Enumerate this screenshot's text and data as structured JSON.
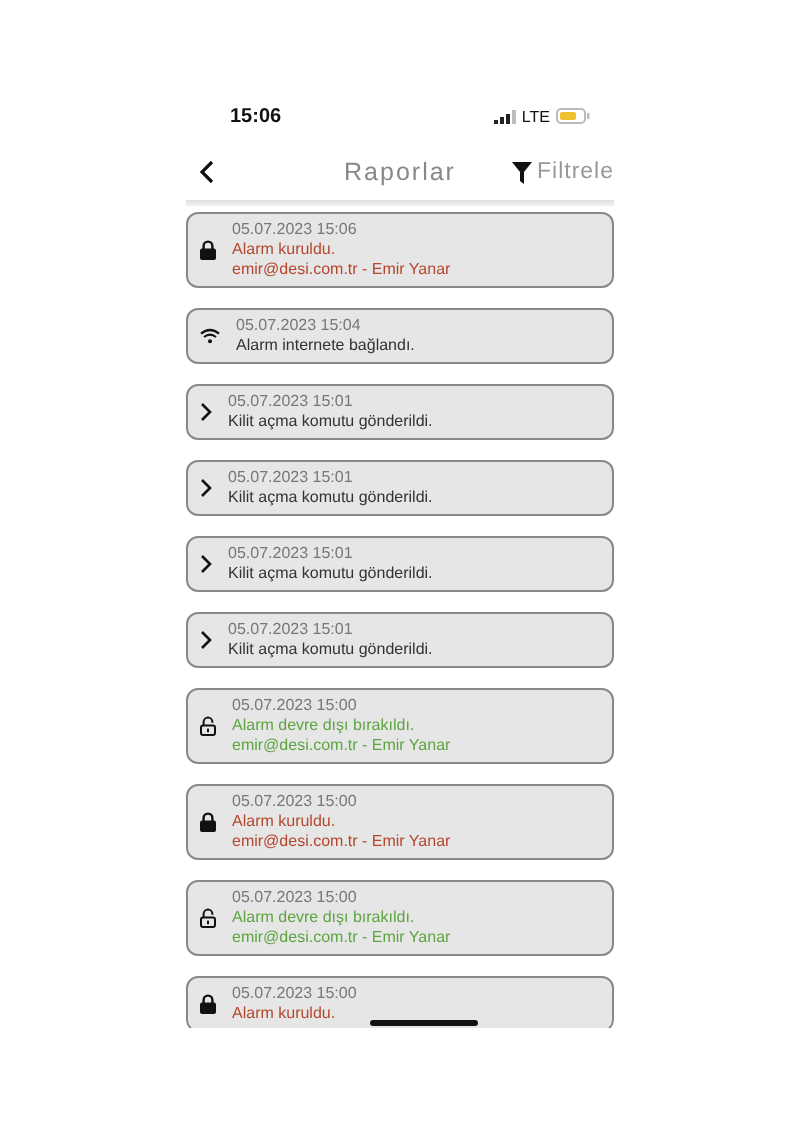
{
  "status_bar": {
    "time": "15:06",
    "network": "LTE"
  },
  "header": {
    "title": "Raporlar",
    "filter_label": "Filtrele"
  },
  "entries": [
    {
      "kind": "locked",
      "date": "05.07.2023 15:06",
      "message": "Alarm kuruldu.",
      "user": "emir@desi.com.tr - Emir Yanar"
    },
    {
      "kind": "wifi",
      "date": "05.07.2023 15:04",
      "message": "Alarm internete bağlandı."
    },
    {
      "kind": "command",
      "date": "05.07.2023 15:01",
      "message": "Kilit açma komutu gönderildi."
    },
    {
      "kind": "command",
      "date": "05.07.2023 15:01",
      "message": "Kilit açma komutu gönderildi."
    },
    {
      "kind": "command",
      "date": "05.07.2023 15:01",
      "message": "Kilit açma komutu gönderildi."
    },
    {
      "kind": "command",
      "date": "05.07.2023 15:01",
      "message": "Kilit açma komutu gönderildi."
    },
    {
      "kind": "unlocked",
      "date": "05.07.2023 15:00",
      "message": "Alarm devre dışı bırakıldı.",
      "user": "emir@desi.com.tr - Emir Yanar"
    },
    {
      "kind": "locked",
      "date": "05.07.2023 15:00",
      "message": "Alarm kuruldu.",
      "user": "emir@desi.com.tr - Emir Yanar"
    },
    {
      "kind": "unlocked",
      "date": "05.07.2023 15:00",
      "message": "Alarm devre dışı bırakıldı.",
      "user": "emir@desi.com.tr - Emir Yanar"
    },
    {
      "kind": "locked",
      "date": "05.07.2023 15:00",
      "message": "Alarm kuruldu."
    }
  ]
}
